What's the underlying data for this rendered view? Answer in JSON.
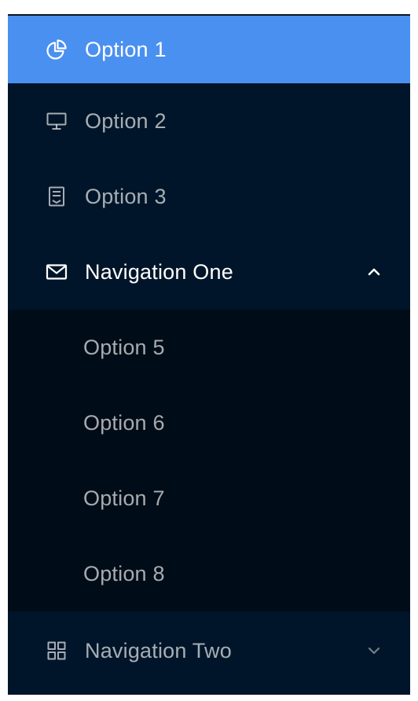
{
  "menu": {
    "items": [
      {
        "label": "Option 1",
        "icon": "pie-chart-icon"
      },
      {
        "label": "Option 2",
        "icon": "desktop-icon"
      },
      {
        "label": "Option 3",
        "icon": "inbox-icon"
      }
    ],
    "nav_one": {
      "label": "Navigation One",
      "icon": "mail-icon",
      "expanded": true,
      "children": [
        {
          "label": "Option 5"
        },
        {
          "label": "Option 6"
        },
        {
          "label": "Option 7"
        },
        {
          "label": "Option 8"
        }
      ]
    },
    "nav_two": {
      "label": "Navigation Two",
      "icon": "appstore-icon",
      "expanded": false
    }
  },
  "colors": {
    "menu_bg": "#001529",
    "submenu_bg": "#000c17",
    "selected_bg": "#4a90f0",
    "text": "rgba(255,255,255,0.65)",
    "text_active": "#ffffff"
  }
}
